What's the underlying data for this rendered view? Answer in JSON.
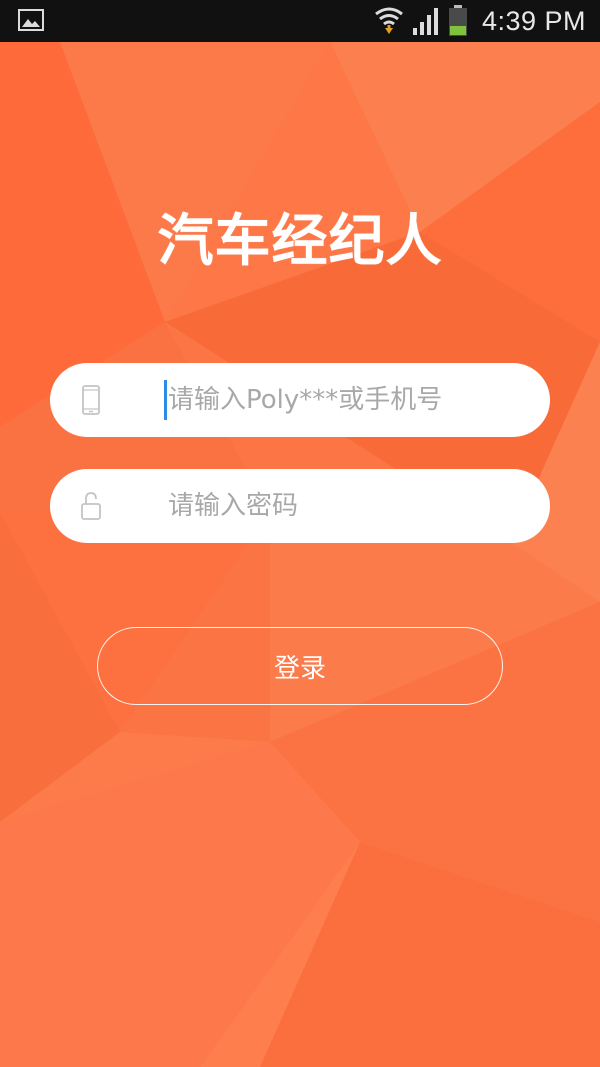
{
  "status_bar": {
    "time": "4:39 PM",
    "icons": [
      "gallery-icon",
      "wifi-icon",
      "signal-icon",
      "battery-icon"
    ]
  },
  "app": {
    "title": "汽车经纪人"
  },
  "login_form": {
    "account": {
      "placeholder": "请输入Poly***或手机号",
      "value": "",
      "icon": "phone-icon"
    },
    "password": {
      "placeholder": "请输入密码",
      "value": "",
      "icon": "lock-icon"
    },
    "submit_label": "登录"
  },
  "colors": {
    "background": "#fb7443",
    "status_bar": "#111111",
    "field_background": "#ffffff",
    "caret": "#2d8ce6",
    "text_on_accent": "#ffffff"
  }
}
